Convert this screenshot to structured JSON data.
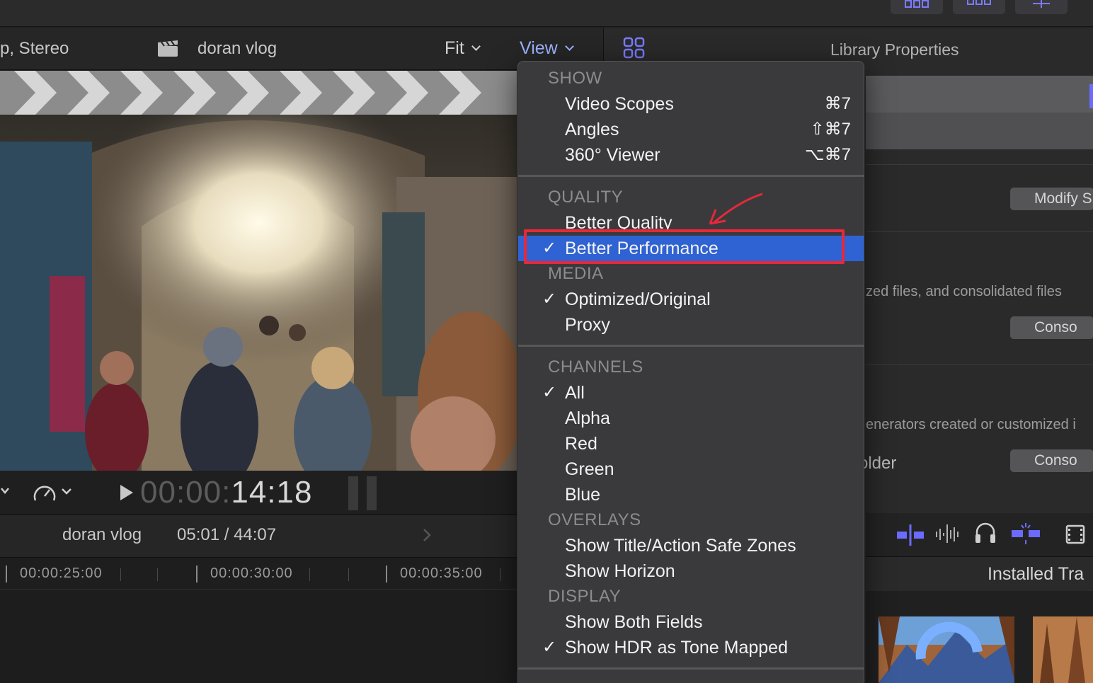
{
  "viewer": {
    "audio_label": "p, Stereo",
    "project_name": "doran vlog",
    "zoom_menu": "Fit",
    "view_menu": "View",
    "timecode_dim": "00:00:",
    "timecode_lit": "14:18"
  },
  "timeline": {
    "project_name": "doran vlog",
    "duration": "05:01 / 44:07",
    "ruler_labels": [
      "00:00:25:00",
      "00:00:30:00",
      "00:00:35:00"
    ]
  },
  "inspector": {
    "title": "Library Properties",
    "modify_button": "Modify S",
    "text_1": "zed files, and consolidated files",
    "consolidate_button_1": "Conso",
    "text_2": "enerators created or customized i",
    "text_3": "older",
    "consolidate_button_2": "Conso",
    "browser_title": "Installed Tra"
  },
  "menu": {
    "sections": {
      "show": "SHOW",
      "quality": "QUALITY",
      "media": "MEDIA",
      "channels": "CHANNELS",
      "overlays": "OVERLAYS",
      "display": "DISPLAY"
    },
    "items": {
      "video_scopes": "Video Scopes",
      "video_scopes_shortcut": "⌘7",
      "angles": "Angles",
      "angles_shortcut": "⇧⌘7",
      "viewer_360": "360° Viewer",
      "viewer_360_shortcut": "⌥⌘7",
      "better_quality": "Better Quality",
      "better_performance": "Better Performance",
      "optimized_original": "Optimized/Original",
      "proxy": "Proxy",
      "all": "All",
      "alpha": "Alpha",
      "red": "Red",
      "green": "Green",
      "blue": "Blue",
      "safe_zones": "Show Title/Action Safe Zones",
      "horizon": "Show Horizon",
      "both_fields": "Show Both Fields",
      "hdr_tone_mapped": "Show HDR as Tone Mapped"
    },
    "checkmark": "✓"
  },
  "colors": {
    "menu_highlight": "#2f62d2",
    "view_menu_text": "#9db4ff",
    "annotation_red": "#e8283a",
    "accent_purple": "#6b6bff"
  }
}
